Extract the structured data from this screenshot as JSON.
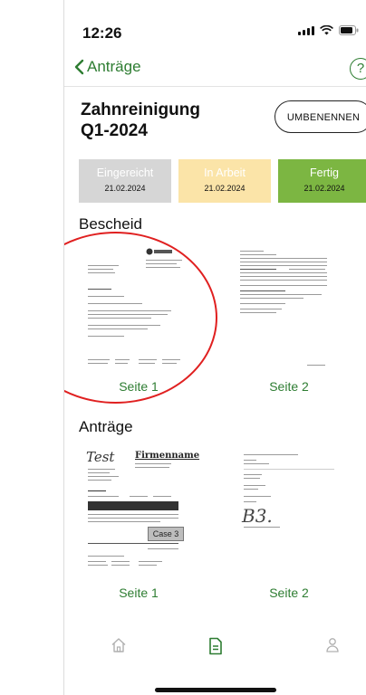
{
  "status_bar": {
    "time": "12:26"
  },
  "nav": {
    "back_label": "Anträge",
    "help_glyph": "?"
  },
  "header": {
    "title": "Zahnreinigung\nQ1-2024",
    "rename_label": "UMBENENNEN"
  },
  "steps": [
    {
      "label": "Eingereicht",
      "date": "21.02.2024",
      "color": "#d6d6d6"
    },
    {
      "label": "In Arbeit",
      "date": "21.02.2024",
      "color": "#fbe4a8"
    },
    {
      "label": "Fertig",
      "date": "21.02.2024",
      "color": "#7cb642"
    }
  ],
  "bescheid": {
    "heading": "Bescheid",
    "pages": [
      {
        "label": "Seite 1"
      },
      {
        "label": "Seite 2"
      }
    ],
    "logo_text": "BGAW"
  },
  "antraege": {
    "heading": "Anträge",
    "pages": [
      {
        "label": "Seite 1"
      },
      {
        "label": "Seite 2"
      }
    ],
    "doc1_handwriting": "Test",
    "doc1_company": "Firmenname",
    "doc1_stamp": "Case 3",
    "doc2_handwriting": "B3."
  },
  "tabbar": {
    "icons": [
      "home-icon",
      "document-icon",
      "person-icon"
    ],
    "active_color": "#2e7d32",
    "inactive_color": "#b0b0b0"
  },
  "accent": "#2e7d32",
  "highlight_circle_color": "#e02020"
}
